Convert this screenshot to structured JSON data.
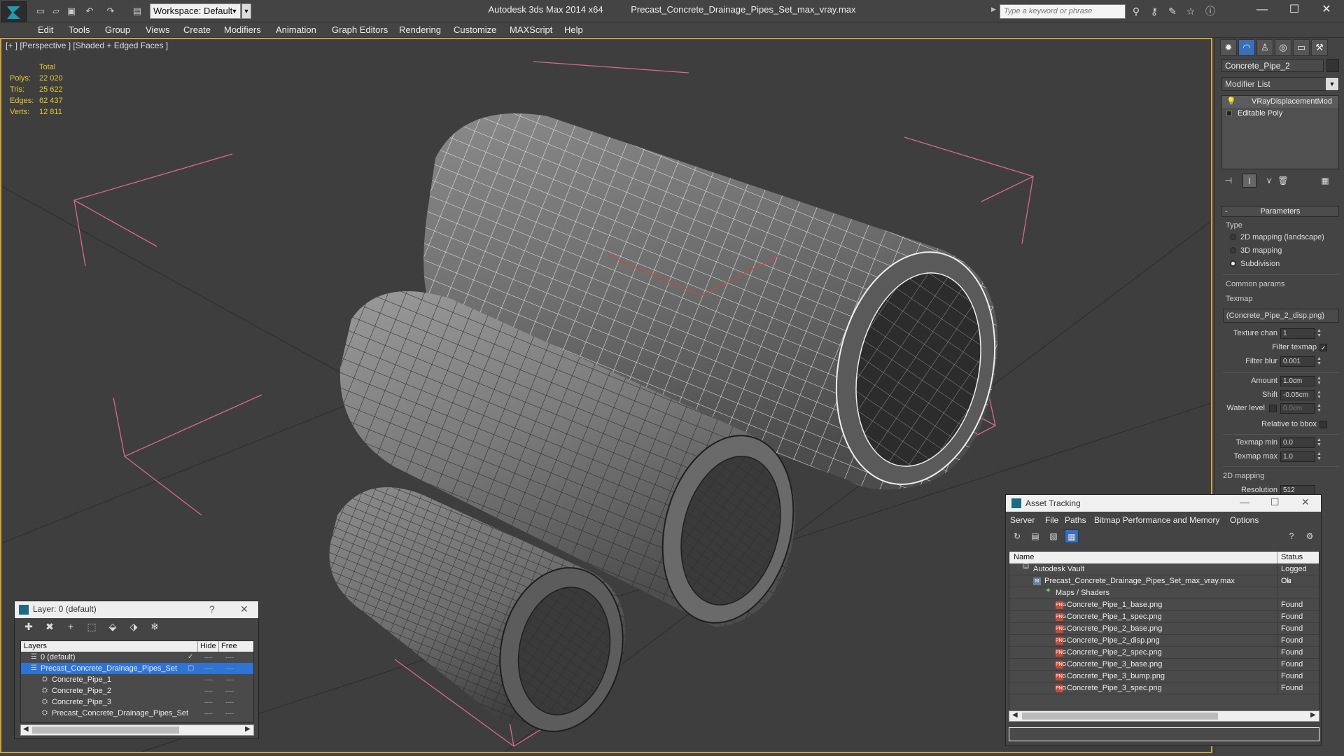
{
  "titlebar": {
    "workspace": "Workspace: Default",
    "app_name": "Autodesk 3ds Max  2014 x64",
    "file_name": "Precast_Concrete_Drainage_Pipes_Set_max_vray.max",
    "search_placeholder": "Type a keyword or phrase"
  },
  "menu": [
    "Edit",
    "Tools",
    "Group",
    "Views",
    "Create",
    "Modifiers",
    "Animation",
    "Graph Editors",
    "Rendering",
    "Customize",
    "MAXScript",
    "Help"
  ],
  "viewport": {
    "label": "[+ ] [Perspective ] [Shaded + Edged Faces ]",
    "stats": {
      "header": "Total",
      "rows": [
        {
          "label": "Polys:",
          "value": "22 020"
        },
        {
          "label": "Tris:",
          "value": "25 622"
        },
        {
          "label": "Edges:",
          "value": "62 437"
        },
        {
          "label": "Verts:",
          "value": "12 811"
        }
      ]
    }
  },
  "command_panel": {
    "object_name": "Concrete_Pipe_2",
    "modifier_list": "Modifier List",
    "stack": [
      "VRayDisplacementMod",
      "Editable Poly"
    ],
    "parameters_title": "Parameters",
    "type_group": "Type",
    "type_options": [
      "2D mapping (landscape)",
      "3D mapping",
      "Subdivision"
    ],
    "common_params": "Common params",
    "texmap_label": "Texmap",
    "texmap_value": "(Concrete_Pipe_2_disp.png)",
    "texture_chan_label": "Texture chan",
    "texture_chan_value": "1",
    "filter_texmap_label": "Filter texmap",
    "filter_blur_label": "Filter blur",
    "filter_blur_value": "0.001",
    "amount_label": "Amount",
    "amount_value": "1.0cm",
    "shift_label": "Shift",
    "shift_value": "-0.05cm",
    "water_level_label": "Water level",
    "water_level_value": "0.0cm",
    "relative_bbox_label": "Relative to bbox",
    "texmap_min_label": "Texmap min",
    "texmap_min_value": "0.0",
    "texmap_max_label": "Texmap max",
    "texmap_max_value": "1.0",
    "mapping2d_group": "2D mapping",
    "resolution_label": "Resolution",
    "resolution_value": "512"
  },
  "layer_dialog": {
    "title": "Layer: 0 (default)",
    "col_layers": "Layers",
    "col_hide": "Hide",
    "col_freeze": "Free",
    "rows": [
      {
        "name": "0 (default)",
        "indent": 0,
        "selected": false
      },
      {
        "name": "Precast_Concrete_Drainage_Pipes_Set",
        "indent": 0,
        "selected": true
      },
      {
        "name": "Concrete_Pipe_1",
        "indent": 1,
        "selected": false
      },
      {
        "name": "Concrete_Pipe_2",
        "indent": 1,
        "selected": false
      },
      {
        "name": "Concrete_Pipe_3",
        "indent": 1,
        "selected": false
      },
      {
        "name": "Precast_Concrete_Drainage_Pipes_Set",
        "indent": 1,
        "selected": false
      }
    ]
  },
  "asset_dialog": {
    "title": "Asset Tracking",
    "menu": [
      "Server",
      "File",
      "Paths",
      "Bitmap Performance and Memory",
      "Options"
    ],
    "col_name": "Name",
    "col_status": "Status",
    "rows": [
      {
        "name": "Autodesk Vault",
        "status": "Logged Ou",
        "type": "vault",
        "indent": 0
      },
      {
        "name": "Precast_Concrete_Drainage_Pipes_Set_max_vray.max",
        "status": "Ok",
        "type": "file",
        "indent": 1
      },
      {
        "name": "Maps / Shaders",
        "status": "",
        "type": "folder",
        "indent": 2
      },
      {
        "name": "Concrete_Pipe_1_base.png",
        "status": "Found",
        "type": "png",
        "indent": 3
      },
      {
        "name": "Concrete_Pipe_1_spec.png",
        "status": "Found",
        "type": "png",
        "indent": 3
      },
      {
        "name": "Concrete_Pipe_2_base.png",
        "status": "Found",
        "type": "png",
        "indent": 3
      },
      {
        "name": "Concrete_Pipe_2_disp.png",
        "status": "Found",
        "type": "png",
        "indent": 3
      },
      {
        "name": "Concrete_Pipe_2_spec.png",
        "status": "Found",
        "type": "png",
        "indent": 3
      },
      {
        "name": "Concrete_Pipe_3_base.png",
        "status": "Found",
        "type": "png",
        "indent": 3
      },
      {
        "name": "Concrete_Pipe_3_bump.png",
        "status": "Found",
        "type": "png",
        "indent": 3
      },
      {
        "name": "Concrete_Pipe_3_spec.png",
        "status": "Found",
        "type": "png",
        "indent": 3
      }
    ]
  }
}
